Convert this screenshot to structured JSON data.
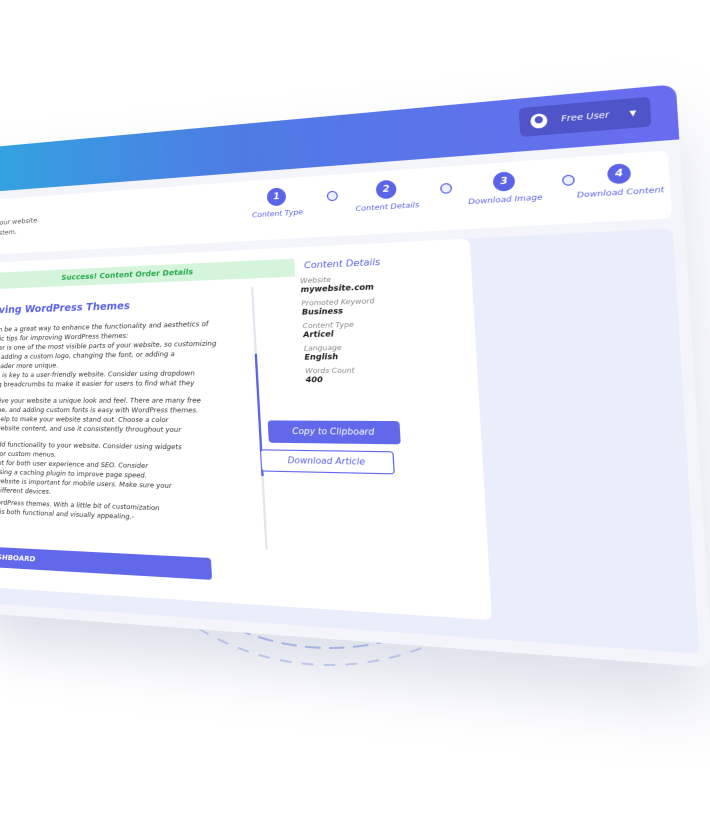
{
  "header": {
    "user_label": "Free User",
    "colors": {
      "gradient_start": "#2fa9e0",
      "gradient_end": "#6a6cf0",
      "accent": "#5b63e6"
    }
  },
  "intro": {
    "line1": "nt to your website.",
    "line2": "the system."
  },
  "steps": [
    {
      "num": "1",
      "label": "Content Type"
    },
    {
      "num": "2",
      "label": "Content Details"
    },
    {
      "num": "3",
      "label": "Download Image"
    },
    {
      "num": "4",
      "label": "Download Content"
    }
  ],
  "success_message": "Success! Content Order Details",
  "article": {
    "title": "proving WordPress Themes",
    "paragraphs": [
      "es can be a great way to enhance the functionality and aesthetics of",
      "o basic tips for improving WordPress themes:",
      "header is one of the most visible parts of your website, so customizing",
      "sider adding a custom logo, changing the font, or adding a",
      "ur header more unique.",
      "ation is key to a user-friendly website. Consider using dropdown",
      "using breadcrumbs to make it easier for users to find what they",
      "an give your website a unique look and feel. There are many free",
      "online, and adding custom fonts is easy with WordPress themes.",
      "an help to make your website stand out. Choose a color",
      "or website content, and use it consistently throughout your",
      "o add functionality to your website. Consider using widgets",
      "ds, or custom menus.",
      "rtant for both user experience and SEO. Consider",
      "d using a caching plugin to improve page speed.",
      "e website is important for mobile users. Make sure your",
      "n different devices.",
      "WordPress themes. With a little bit of customization",
      "at is both functional and visually appealing.-"
    ]
  },
  "dashboard_button": "ASHBOARD",
  "details": {
    "heading": "Content  Details",
    "fields": [
      {
        "key": "Website",
        "value": "mywebsite.com"
      },
      {
        "key": "Promoted Keyword",
        "value": "Business"
      },
      {
        "key": "Content Type",
        "value": "Articel"
      },
      {
        "key": "Language",
        "value": "English"
      },
      {
        "key": "Words Count",
        "value": "400"
      }
    ]
  },
  "actions": {
    "copy_label": "Copy to Clipboard",
    "download_label": "Download Article"
  }
}
